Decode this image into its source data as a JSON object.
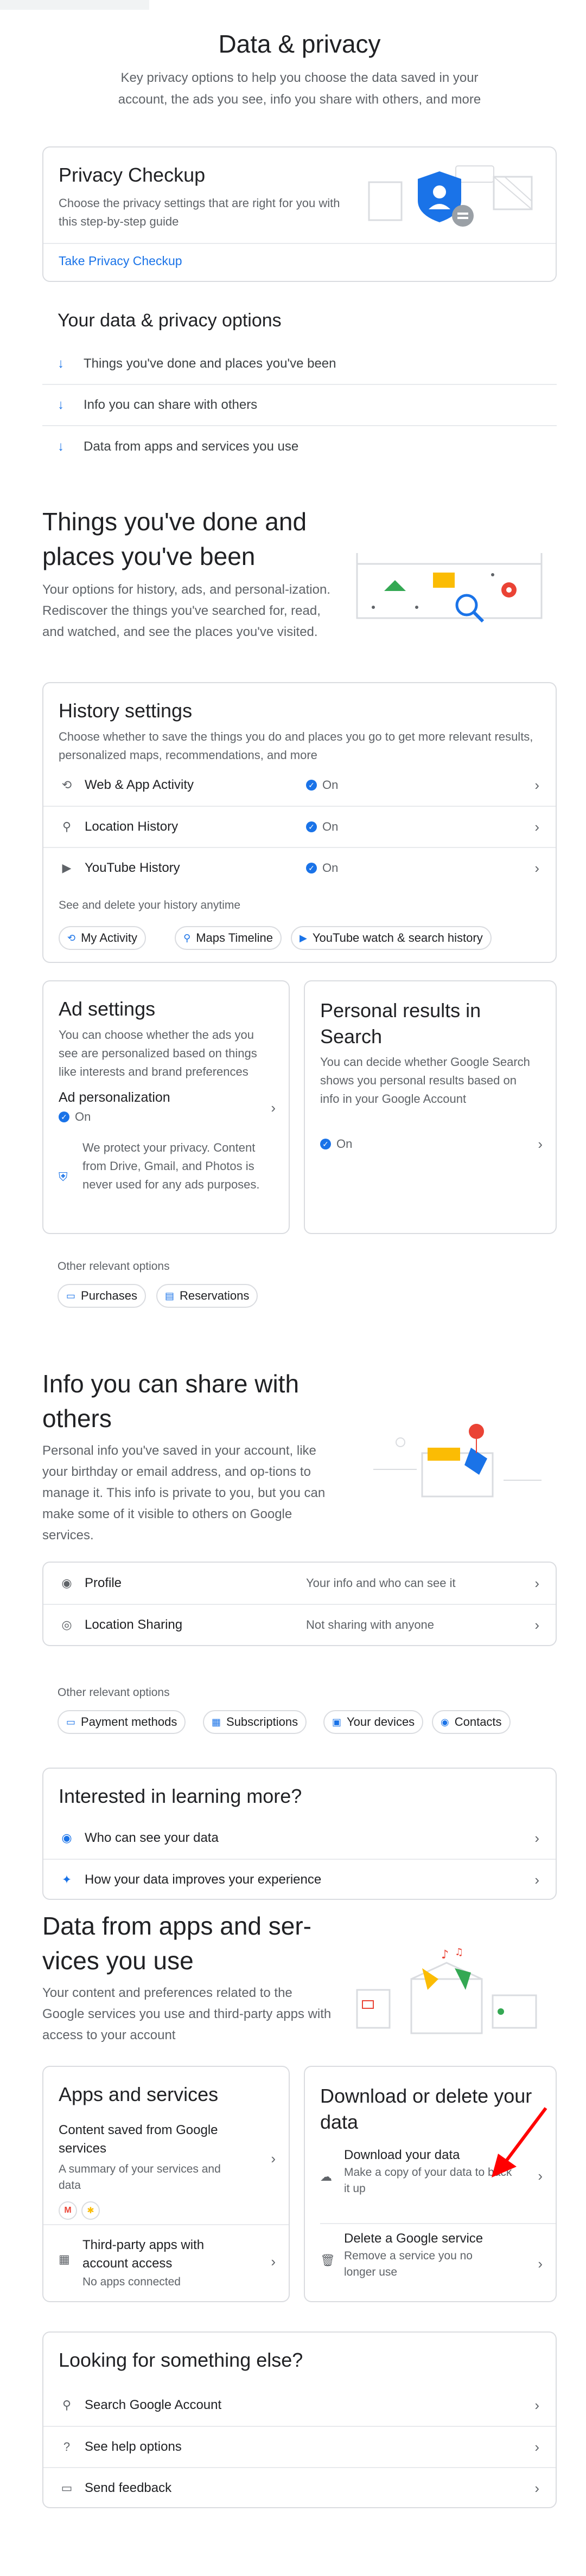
{
  "hero": {
    "title": "Data & privacy",
    "description": "Key privacy options to help you choose the data saved in your account, the ads you see, info you share with others, and more"
  },
  "privacy_checkup": {
    "title": "Privacy Checkup",
    "description": "Choose the privacy settings that are right for you with this step-by-step guide",
    "link": "Take Privacy Checkup"
  },
  "options": {
    "title": "Your data & privacy options",
    "items": [
      "Things you've done and places you've been",
      "Info you can share with others",
      "Data from apps and services you use"
    ]
  },
  "things": {
    "title_line1": "Things you've done and",
    "title_line2": "places you've been",
    "description": "Your options for history, ads, and personal-ization. Rediscover the things you've searched for, read, and watched, and see the places you've visited."
  },
  "history": {
    "title": "History settings",
    "description": "Choose whether to save the things you do and places you go to get more relevant results, personalized maps, recommendations, and more",
    "rows": [
      {
        "label": "Web & App Activity",
        "status": "On"
      },
      {
        "label": "Location History",
        "status": "On"
      },
      {
        "label": "YouTube History",
        "status": "On"
      }
    ],
    "see_delete": "See and delete your history anytime",
    "chips": [
      "My Activity",
      "Maps Timeline",
      "YouTube watch & search history"
    ]
  },
  "ad_settings": {
    "title": "Ad settings",
    "description": "You can choose whether the ads you see are personalized based on things like interests and brand preferences",
    "sub_title": "Ad personalization",
    "status": "On",
    "note": "We protect your privacy. Content from Drive, Gmail, and Photos is never used for any ads purposes."
  },
  "personal_results": {
    "title": "Personal results in Search",
    "description": "You can decide whether Google Search shows you personal results based on info in your Google Account",
    "status": "On"
  },
  "other_options_1": {
    "label": "Other relevant options",
    "chips": [
      "Purchases",
      "Reservations"
    ]
  },
  "info": {
    "title_line1": "Info you can share with",
    "title_line2": "others",
    "description": "Personal info you've saved in your account, like your birthday or email address, and op-tions to manage it. This info is private to you, but you can make some of it visible to others on Google services.",
    "rows": [
      {
        "label": "Profile",
        "status": "Your info and who can see it"
      },
      {
        "label": "Location Sharing",
        "status": "Not sharing with anyone"
      }
    ]
  },
  "other_options_2": {
    "label": "Other relevant options",
    "chips": [
      "Payment methods",
      "Subscriptions",
      "Your devices",
      "Contacts"
    ]
  },
  "learning": {
    "title": "Interested in learning more?",
    "items": [
      "Who can see your data",
      "How your data improves your experience"
    ]
  },
  "apps": {
    "title_line1": "Data from apps and ser-",
    "title_line2": "vices you use",
    "description": "Your content and preferences related to the Google services you use and third-party apps with access to your account"
  },
  "apps_services": {
    "title": "Apps and services",
    "content_title": "Content saved from Google services",
    "content_desc": "A summary of your services and data",
    "third_party_title": "Third-party apps with account access",
    "third_party_desc": "No apps connected"
  },
  "download": {
    "title": "Download or delete your data",
    "dl_title": "Download your data",
    "dl_desc": "Make a copy of your data to back it up",
    "del_title": "Delete a Google service",
    "del_desc": "Remove a service you no longer use"
  },
  "looking": {
    "title": "Looking for something else?",
    "items": [
      "Search Google Account",
      "See help options",
      "Send feedback"
    ]
  }
}
